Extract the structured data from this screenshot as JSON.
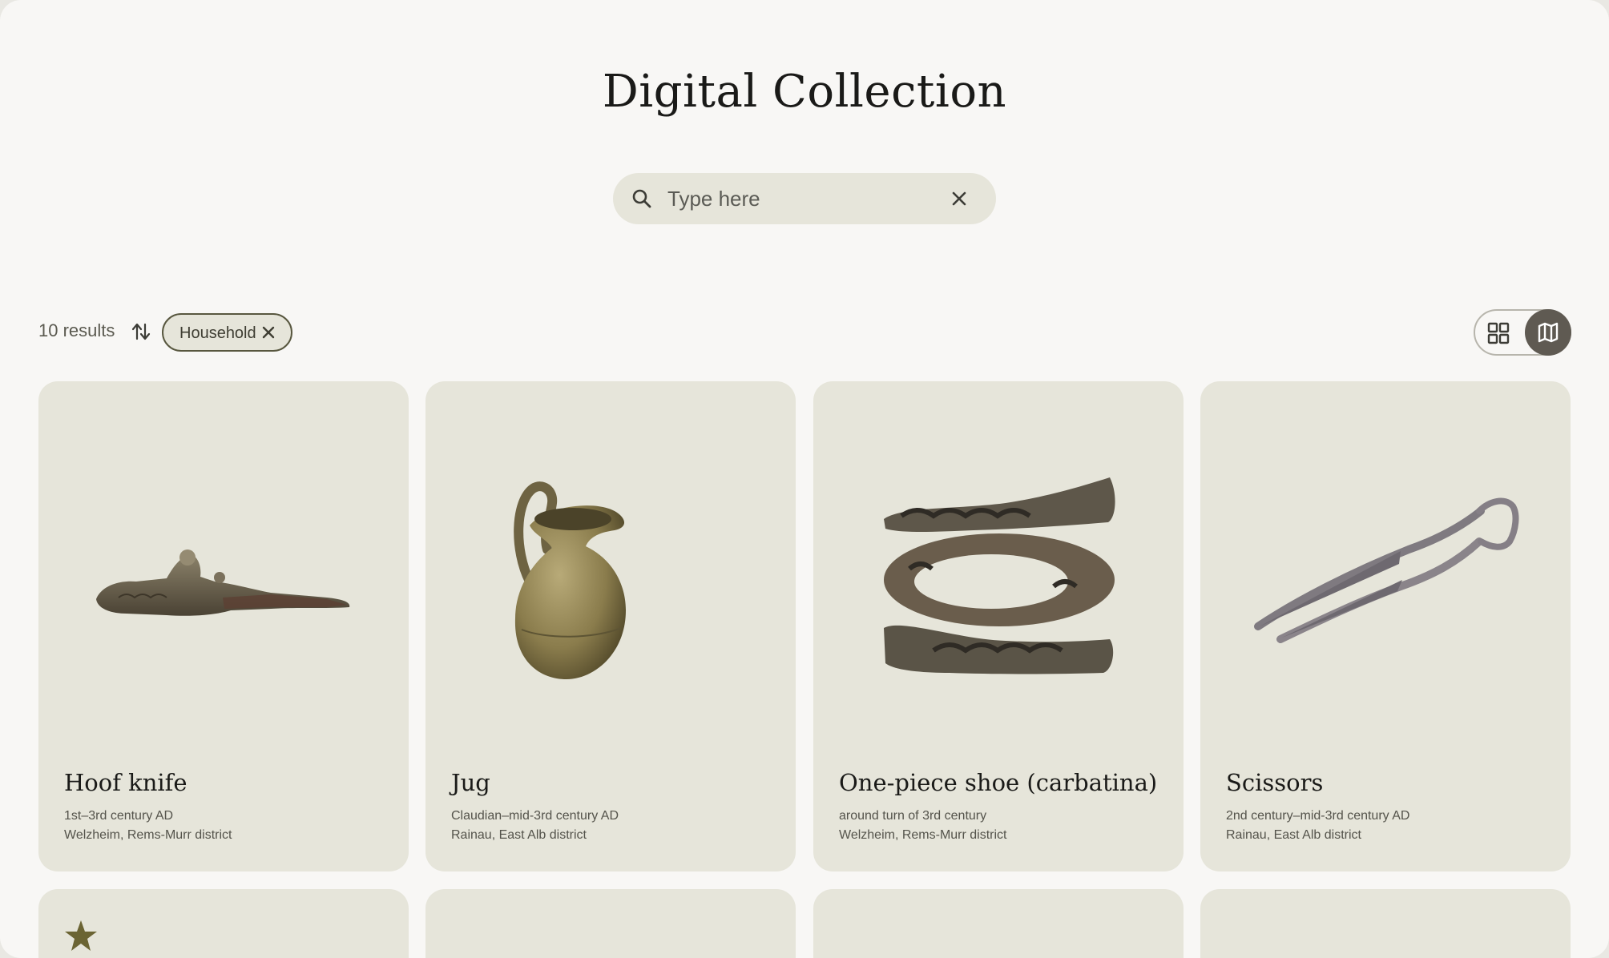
{
  "page": {
    "title": "Digital Collection"
  },
  "search": {
    "placeholder": "Type here",
    "value": ""
  },
  "filters": {
    "results_count": "10 results",
    "chips": [
      {
        "label": "Household"
      }
    ]
  },
  "view_toggle": {
    "active": "map"
  },
  "colors": {
    "accent": "#58573f",
    "card_bg": "#e6e5da",
    "page_bg": "#f8f7f5",
    "star": "#6b6433"
  },
  "cards": [
    {
      "name": "Hoof knife",
      "date": "1st–3rd century AD",
      "place": "Welzheim, Rems-Murr district",
      "icon": "hoof-knife-image"
    },
    {
      "name": "Jug",
      "date": "Claudian–mid-3rd century AD",
      "place": "Rainau, East Alb district",
      "icon": "jug-image"
    },
    {
      "name": "One-piece shoe (carbatina)",
      "date": "around turn of 3rd century",
      "place": "Welzheim, Rems-Murr district",
      "icon": "shoe-image"
    },
    {
      "name": "Scissors",
      "date": "2nd century–mid-3rd century AD",
      "place": "Rainau, East Alb district",
      "icon": "scissors-image"
    }
  ],
  "next_row": [
    {
      "featured": true,
      "icon": "star-icon"
    },
    {},
    {},
    {}
  ]
}
